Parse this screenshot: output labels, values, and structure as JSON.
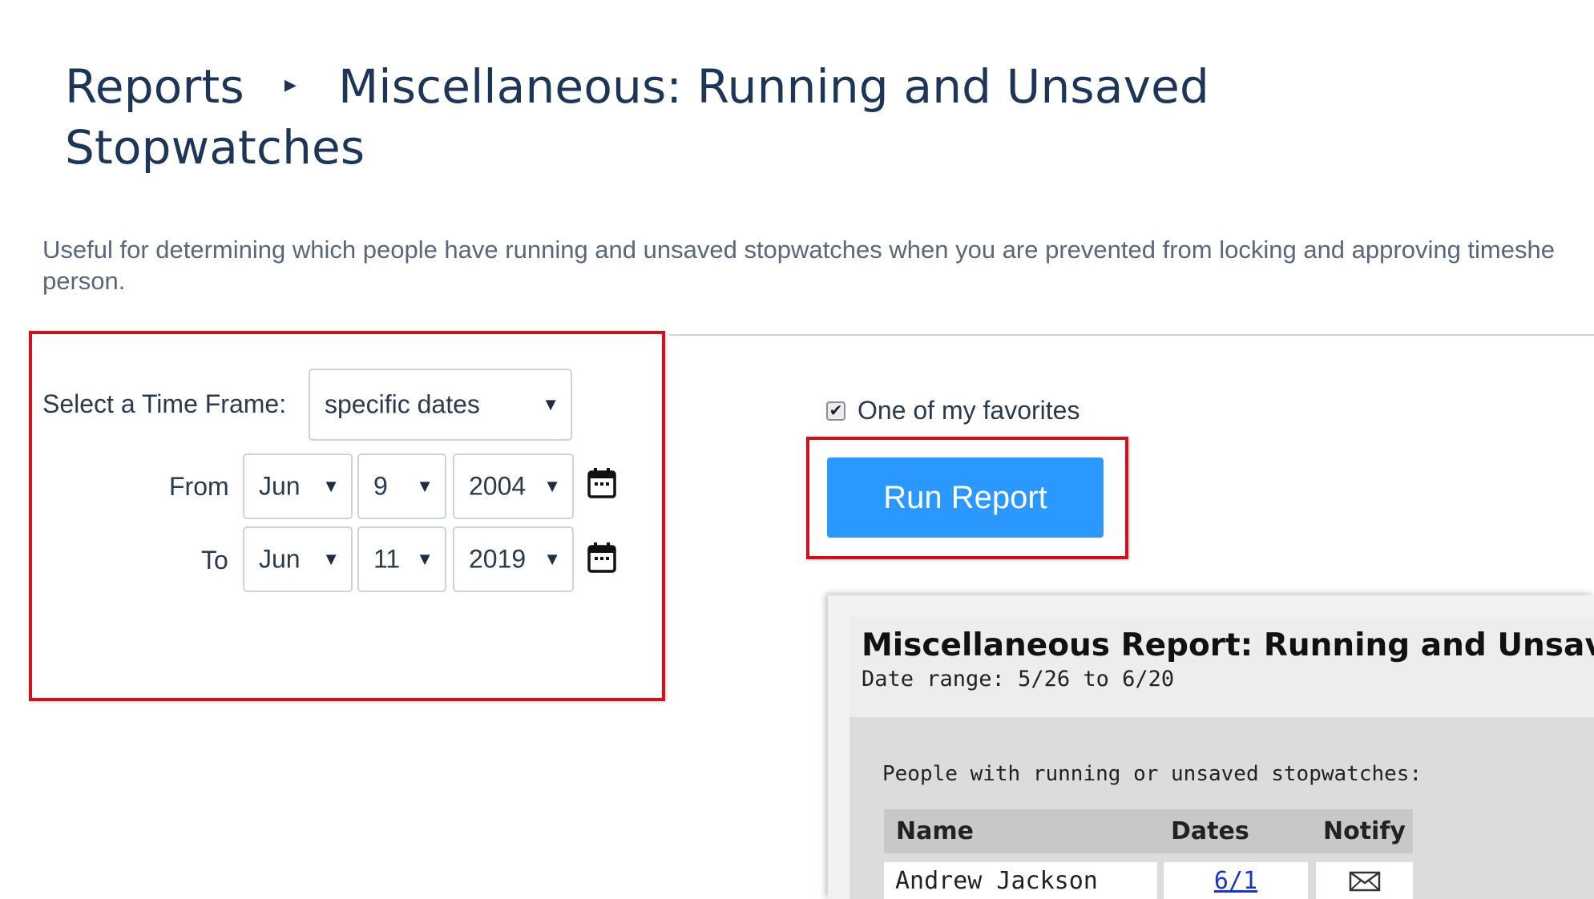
{
  "breadcrumb": {
    "parent": "Reports",
    "separator": "▸",
    "title": "Miscellaneous: Running and Unsaved Stopwatches"
  },
  "description": "Useful for determining which people have running and unsaved stopwatches when you are prevented from locking and approving timeshe",
  "description_line2": "person.",
  "form": {
    "timeframe_label": "Select a Time Frame:",
    "timeframe_value": "specific dates",
    "from_label": "From",
    "from": {
      "month": "Jun",
      "day": "9",
      "year": "2004"
    },
    "to_label": "To",
    "to": {
      "month": "Jun",
      "day": "11",
      "year": "2019"
    }
  },
  "favorite": {
    "label": "One of my favorites",
    "checked": true
  },
  "run_button": "Run Report",
  "preview": {
    "title": "Miscellaneous Report: Running and Unsav",
    "date_range": "Date range: 5/26 to 6/20",
    "caption": "People with running or unsaved stopwatches:",
    "columns": [
      "Name",
      "Dates",
      "Notify"
    ],
    "rows": [
      {
        "name": "Andrew Jackson",
        "dates": "6/1",
        "notify_icon": "envelope-icon"
      }
    ]
  },
  "colors": {
    "highlight": "#d0111b",
    "button": "#2a98ff",
    "title": "#1d3557",
    "link": "#1a34c8"
  }
}
